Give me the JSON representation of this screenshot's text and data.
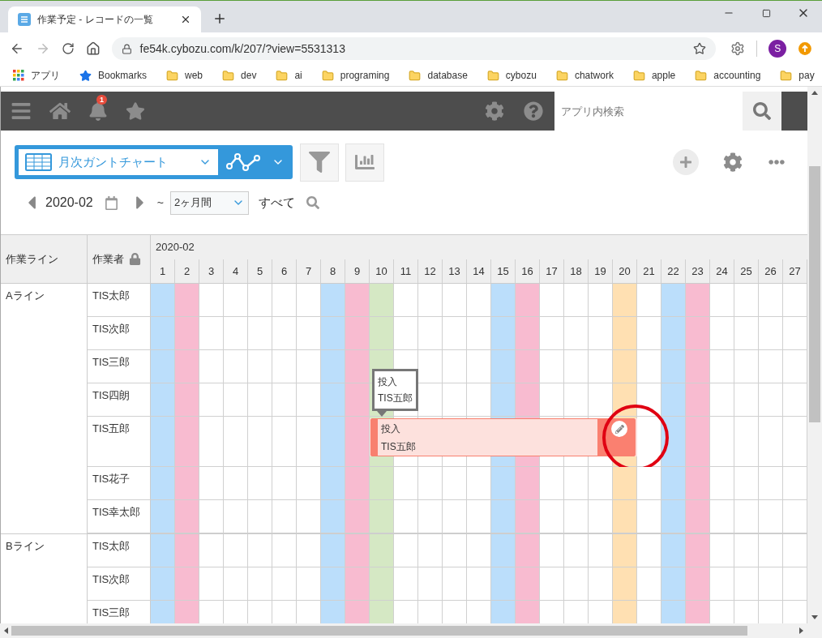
{
  "browser": {
    "tab_title": "作業予定 - レコードの一覧",
    "url": "fe54k.cybozu.com/k/207/?view=5531313",
    "profile_initial": "S",
    "bookmarks": [
      {
        "label": "アプリ",
        "kind": "apps"
      },
      {
        "label": "Bookmarks",
        "kind": "star"
      },
      {
        "label": "web",
        "kind": "folder"
      },
      {
        "label": "dev",
        "kind": "folder"
      },
      {
        "label": "ai",
        "kind": "folder"
      },
      {
        "label": "programing",
        "kind": "folder"
      },
      {
        "label": "database",
        "kind": "folder"
      },
      {
        "label": "cybozu",
        "kind": "folder"
      },
      {
        "label": "chatwork",
        "kind": "folder"
      },
      {
        "label": "apple",
        "kind": "folder"
      },
      {
        "label": "accounting",
        "kind": "folder"
      },
      {
        "label": "pay",
        "kind": "folder"
      }
    ]
  },
  "app_header": {
    "notification_count": "1",
    "search": {
      "placeholder": "アプリ内検索"
    }
  },
  "toolbar": {
    "view_name": "月次ガントチャート",
    "period": "2020-02",
    "range_separator": "~",
    "range": "2ヶ月間",
    "filter": "すべて"
  },
  "gantt": {
    "columns": [
      "作業ライン",
      "作業者"
    ],
    "month": "2020-02",
    "days": [
      {
        "label": "1",
        "color": "#bbdefb"
      },
      {
        "label": "2",
        "color": "#f8bbd0"
      },
      {
        "label": "3"
      },
      {
        "label": "4"
      },
      {
        "label": "5"
      },
      {
        "label": "6"
      },
      {
        "label": "7"
      },
      {
        "label": "8",
        "color": "#bbdefb"
      },
      {
        "label": "9",
        "color": "#f8bbd0"
      },
      {
        "label": "10",
        "color": "#d5e8c4"
      },
      {
        "label": "11"
      },
      {
        "label": "12"
      },
      {
        "label": "13"
      },
      {
        "label": "14"
      },
      {
        "label": "15",
        "color": "#bbdefb"
      },
      {
        "label": "16",
        "color": "#f8bbd0"
      },
      {
        "label": "17"
      },
      {
        "label": "18"
      },
      {
        "label": "19"
      },
      {
        "label": "20",
        "color": "#ffe0b2"
      },
      {
        "label": "21"
      },
      {
        "label": "22",
        "color": "#bbdefb"
      },
      {
        "label": "23",
        "color": "#f8bbd0"
      },
      {
        "label": "24"
      },
      {
        "label": "25"
      },
      {
        "label": "26"
      },
      {
        "label": "27"
      }
    ],
    "groups": [
      {
        "line": "Aライン",
        "workers": [
          {
            "name": "TIS太郎"
          },
          {
            "name": "TIS次郎"
          },
          {
            "name": "TIS三郎"
          },
          {
            "name": "TIS四朗"
          },
          {
            "name": "TIS五郎",
            "bars": [
              {
                "title": "投入",
                "assignee": "TIS五郎",
                "covers": [
                  false,
                  false,
                  false,
                  false,
                  false,
                  false,
                  false,
                  false,
                  false,
                  true,
                  true,
                  true,
                  true,
                  true,
                  true,
                  true,
                  true,
                  true,
                  true,
                  true,
                  false,
                  false,
                  false,
                  false,
                  false,
                  false,
                  false
                ],
                "tooltip": {
                  "title": "投入",
                  "assignee": "TIS五郎"
                }
              }
            ]
          },
          {
            "name": "TIS花子"
          },
          {
            "name": "TIS幸太郎"
          }
        ]
      },
      {
        "line": "Bライン",
        "workers": [
          {
            "name": "TIS太郎"
          },
          {
            "name": "TIS次郎"
          },
          {
            "name": "TIS三郎"
          }
        ]
      }
    ]
  }
}
